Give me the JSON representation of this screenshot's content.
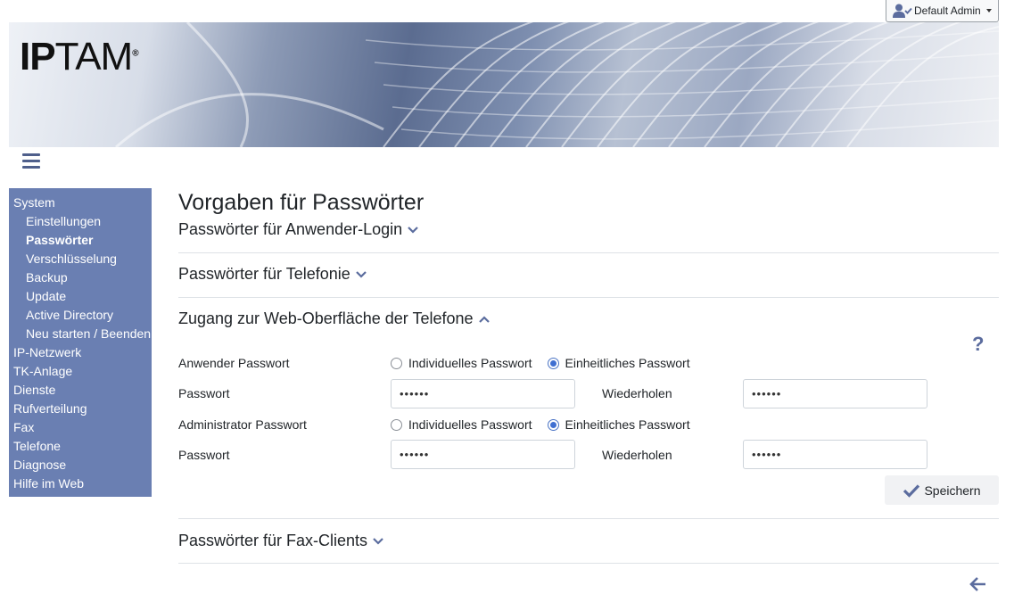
{
  "user_menu": {
    "label": "Default Admin",
    "icon": "user-check-icon"
  },
  "banner": {
    "logo_bold": "IP",
    "logo_rest": "TAM",
    "logo_mark": "®"
  },
  "sidebar": {
    "items": [
      {
        "label": "System",
        "level": 0,
        "active": false
      },
      {
        "label": "Einstellungen",
        "level": 1,
        "active": false
      },
      {
        "label": "Passwörter",
        "level": 1,
        "active": true
      },
      {
        "label": "Verschlüsselung",
        "level": 1,
        "active": false
      },
      {
        "label": "Backup",
        "level": 1,
        "active": false
      },
      {
        "label": "Update",
        "level": 1,
        "active": false
      },
      {
        "label": "Active Directory",
        "level": 1,
        "active": false
      },
      {
        "label": "Neu starten / Beenden",
        "level": 1,
        "active": false
      },
      {
        "label": "IP-Netzwerk",
        "level": 0,
        "active": false
      },
      {
        "label": "TK-Anlage",
        "level": 0,
        "active": false
      },
      {
        "label": "Dienste",
        "level": 0,
        "active": false
      },
      {
        "label": "Rufverteilung",
        "level": 0,
        "active": false
      },
      {
        "label": "Fax",
        "level": 0,
        "active": false
      },
      {
        "label": "Telefone",
        "level": 0,
        "active": false
      },
      {
        "label": "Diagnose",
        "level": 0,
        "active": false
      },
      {
        "label": "Hilfe im Web",
        "level": 0,
        "active": false
      }
    ]
  },
  "main": {
    "title": "Vorgaben für Passwörter",
    "sections": {
      "login": {
        "label": "Passwörter für Anwender-Login",
        "expanded": false
      },
      "telephony": {
        "label": "Passwörter für Telefonie",
        "expanded": false
      },
      "web": {
        "label": "Zugang zur Web-Oberfläche der Telefone",
        "expanded": true
      },
      "fax": {
        "label": "Passwörter für Fax-Clients",
        "expanded": false
      }
    },
    "help": "?",
    "user_pw": {
      "label": "Anwender Passwort",
      "opt_individual": "Individuelles Passwort",
      "opt_uniform": "Einheitliches Passwort",
      "selected": "uniform",
      "password_label": "Passwort",
      "password_value": "••••••",
      "repeat_label": "Wiederholen",
      "repeat_value": "••••••"
    },
    "admin_pw": {
      "label": "Administrator Passwort",
      "opt_individual": "Individuelles Passwort",
      "opt_uniform": "Einheitliches Passwort",
      "selected": "uniform",
      "password_label": "Passwort",
      "password_value": "••••••",
      "repeat_label": "Wiederholen",
      "repeat_value": "••••••"
    },
    "save_label": "Speichern"
  },
  "colors": {
    "sidebar_bg": "#6a7fb2",
    "accent": "#5b6c9e",
    "radio_on": "#3f6fd1"
  }
}
